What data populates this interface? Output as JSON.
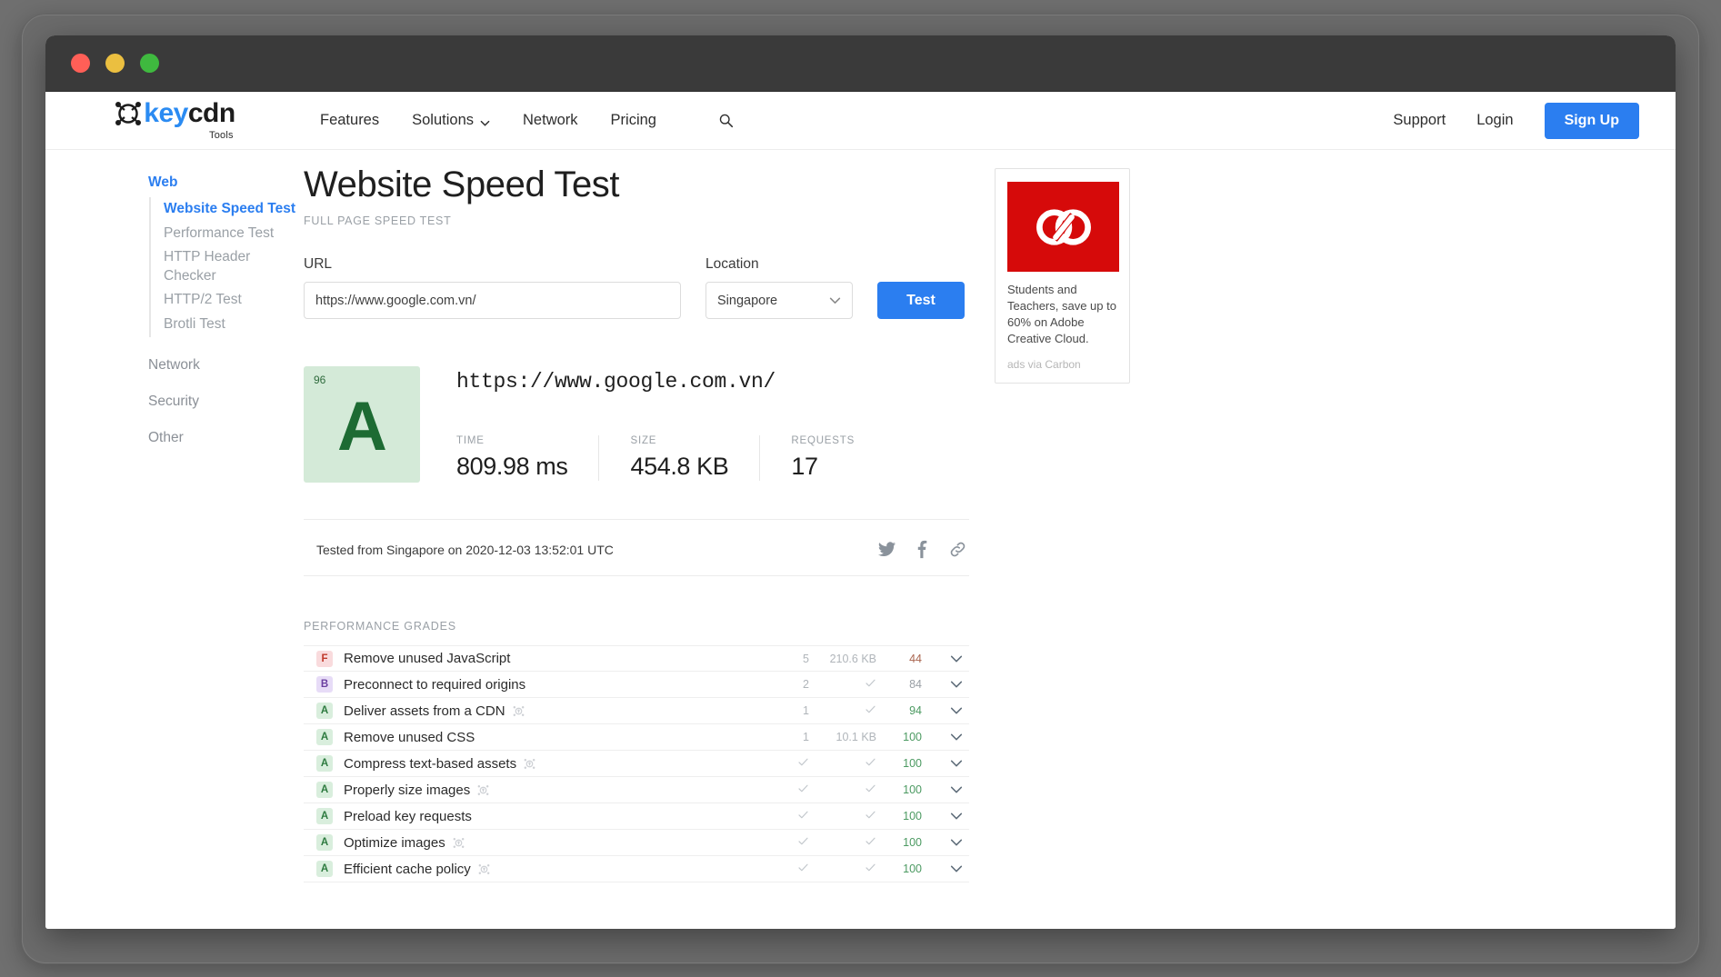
{
  "window": {
    "traffic_lights": [
      "close",
      "minimize",
      "zoom"
    ]
  },
  "nav": {
    "logo": {
      "text_key": "key",
      "text_cdn": "cdn",
      "sub": "Tools"
    },
    "links": [
      {
        "label": "Features",
        "has_chevron": false
      },
      {
        "label": "Solutions",
        "has_chevron": true
      },
      {
        "label": "Network",
        "has_chevron": false
      },
      {
        "label": "Pricing",
        "has_chevron": false
      }
    ],
    "search_icon": "search-icon",
    "right": [
      {
        "label": "Support"
      },
      {
        "label": "Login"
      }
    ],
    "signup_label": "Sign Up",
    "accent_color": "#2b7ef0"
  },
  "sidebar": {
    "groups": [
      {
        "head": "Web",
        "active": true,
        "items": [
          {
            "label": "Website Speed Test",
            "active": true
          },
          {
            "label": "Performance Test",
            "active": false
          },
          {
            "label": "HTTP Header Checker",
            "active": false
          },
          {
            "label": "HTTP/2 Test",
            "active": false
          },
          {
            "label": "Brotli Test",
            "active": false
          }
        ]
      },
      {
        "head": "Network",
        "active": false,
        "items": []
      },
      {
        "head": "Security",
        "active": false,
        "items": []
      },
      {
        "head": "Other",
        "active": false,
        "items": []
      }
    ]
  },
  "main": {
    "title": "Website Speed Test",
    "subtitle": "FULL PAGE SPEED TEST",
    "form": {
      "url_label": "URL",
      "url_value": "https://www.google.com.vn/",
      "url_placeholder": "https://www.google.com.vn/",
      "location_label": "Location",
      "location_value": "Singapore",
      "test_label": "Test"
    },
    "result": {
      "score": "96",
      "grade": "A",
      "grade_bg": "#d4ead8",
      "grade_color": "#1d6b33",
      "url": "https://www.google.com.vn/",
      "metrics": [
        {
          "label": "TIME",
          "value": "809.98 ms"
        },
        {
          "label": "SIZE",
          "value": "454.8 KB"
        },
        {
          "label": "REQUESTS",
          "value": "17"
        }
      ],
      "tested_text": "Tested from Singapore on 2020-12-03 13:52:01 UTC",
      "socials": [
        "twitter-icon",
        "facebook-icon",
        "link-icon"
      ]
    },
    "grades_title": "PERFORMANCE GRADES",
    "grades": [
      {
        "grade": "F",
        "label": "Remove unused JavaScript",
        "cdn_mark": false,
        "count": "5",
        "size": "210.6 KB",
        "score": "44",
        "score_state": "bad"
      },
      {
        "grade": "B",
        "label": "Preconnect to required origins",
        "cdn_mark": false,
        "count": "2",
        "size": "check",
        "score": "84",
        "score_state": "neutral"
      },
      {
        "grade": "A",
        "label": "Deliver assets from a CDN",
        "cdn_mark": true,
        "count": "1",
        "size": "check",
        "score": "94",
        "score_state": "good"
      },
      {
        "grade": "A",
        "label": "Remove unused CSS",
        "cdn_mark": false,
        "count": "1",
        "size": "10.1 KB",
        "score": "100",
        "score_state": "good"
      },
      {
        "grade": "A",
        "label": "Compress text-based assets",
        "cdn_mark": true,
        "count": "check",
        "size": "check",
        "score": "100",
        "score_state": "good"
      },
      {
        "grade": "A",
        "label": "Properly size images",
        "cdn_mark": true,
        "count": "check",
        "size": "check",
        "score": "100",
        "score_state": "good"
      },
      {
        "grade": "A",
        "label": "Preload key requests",
        "cdn_mark": false,
        "count": "check",
        "size": "check",
        "score": "100",
        "score_state": "good"
      },
      {
        "grade": "A",
        "label": "Optimize images",
        "cdn_mark": true,
        "count": "check",
        "size": "check",
        "score": "100",
        "score_state": "good"
      },
      {
        "grade": "A",
        "label": "Efficient cache policy",
        "cdn_mark": true,
        "count": "check",
        "size": "check",
        "score": "100",
        "score_state": "good"
      }
    ]
  },
  "aside": {
    "ad": {
      "image_alt": "adobe-creative-cloud-logo",
      "image_bg": "#d60a0a",
      "text": "Students and Teachers, save up to 60% on Adobe Creative Cloud.",
      "credit": "ads via Carbon"
    }
  }
}
